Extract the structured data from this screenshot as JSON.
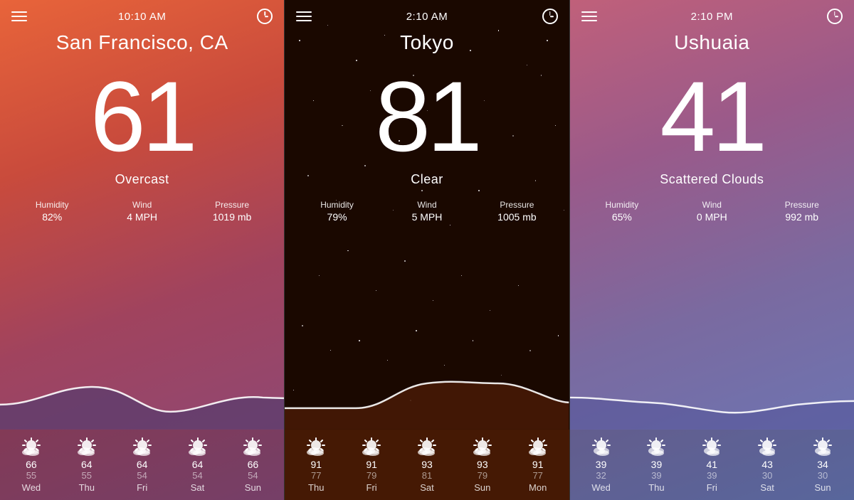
{
  "panels": [
    {
      "id": "sf",
      "time": "10:10 AM",
      "city": "San Francisco, CA",
      "temp": "61",
      "condition": "Overcast",
      "humidity": "82%",
      "wind": "4 MPH",
      "pressure": "1019 mb",
      "waveColor": "rgba(140,90,140,0.6)",
      "waveFillTop": "rgba(100,70,120,0.7)",
      "waveFillBottom": "rgba(80,60,110,0.9)",
      "forecast": [
        {
          "day": "Wed",
          "high": "66",
          "low": "55"
        },
        {
          "day": "Thu",
          "high": "64",
          "low": "55"
        },
        {
          "day": "Fri",
          "high": "64",
          "low": "54"
        },
        {
          "day": "Sat",
          "high": "64",
          "low": "54"
        },
        {
          "day": "Sun",
          "high": "66",
          "low": "54"
        }
      ]
    },
    {
      "id": "tokyo",
      "time": "2:10 AM",
      "city": "Tokyo",
      "temp": "81",
      "condition": "Clear",
      "humidity": "79%",
      "wind": "5 MPH",
      "pressure": "1005 mb",
      "forecast": [
        {
          "day": "Thu",
          "high": "91",
          "low": "77"
        },
        {
          "day": "Fri",
          "high": "91",
          "low": "79"
        },
        {
          "day": "Sat",
          "high": "93",
          "low": "81"
        },
        {
          "day": "Sun",
          "high": "93",
          "low": "79"
        },
        {
          "day": "Mon",
          "high": "91",
          "low": "77"
        }
      ]
    },
    {
      "id": "ushuaia",
      "time": "2:10 PM",
      "city": "Ushuaia",
      "temp": "41",
      "condition": "Scattered Clouds",
      "humidity": "65%",
      "wind": "0 MPH",
      "pressure": "992 mb",
      "forecast": [
        {
          "day": "Wed",
          "high": "39",
          "low": "32"
        },
        {
          "day": "Thu",
          "high": "39",
          "low": "39"
        },
        {
          "day": "Fri",
          "high": "41",
          "low": "39"
        },
        {
          "day": "Sat",
          "high": "43",
          "low": "30"
        },
        {
          "day": "Sun",
          "high": "34",
          "low": "30"
        }
      ]
    }
  ],
  "labels": {
    "humidity": "Humidity",
    "wind": "Wind",
    "pressure": "Pressure"
  }
}
